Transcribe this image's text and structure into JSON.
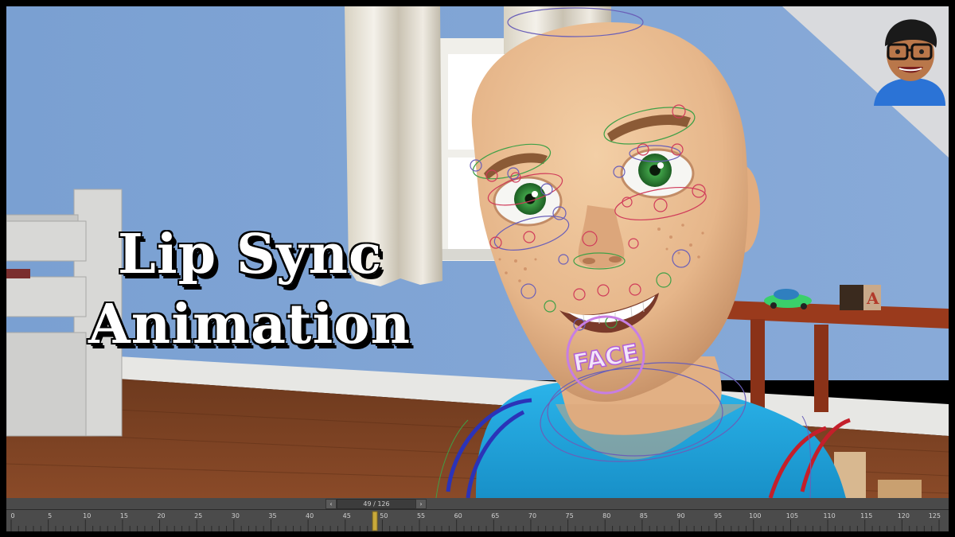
{
  "title": {
    "line1": "Lip Sync",
    "line2": "Animation"
  },
  "face_control_label": "FACE",
  "timeline": {
    "frame_label": "49 / 126",
    "prev_icon": "chevron-left-icon",
    "next_icon": "chevron-right-icon",
    "current_frame": 49,
    "total_frames": 126,
    "range_start": 0,
    "range_end": 125,
    "tick_labels": [
      "0",
      "5",
      "10",
      "15",
      "20",
      "25",
      "30",
      "35",
      "40",
      "45",
      "50",
      "55",
      "60",
      "65",
      "70",
      "75",
      "80",
      "85",
      "90",
      "95",
      "100",
      "105",
      "110",
      "115",
      "120",
      "125"
    ]
  },
  "colors": {
    "wall": "#7ea2d3",
    "floor": "#7a3f22",
    "shirt": "#1fa6de",
    "skin": "#ecc197",
    "iris": "#2f8f3a",
    "face_ring": "#c77ee3",
    "timeline_bg": "#4b4b4b",
    "scrubber": "#c9a93a"
  },
  "avatar_icon": "cartoon-avatar-icon"
}
